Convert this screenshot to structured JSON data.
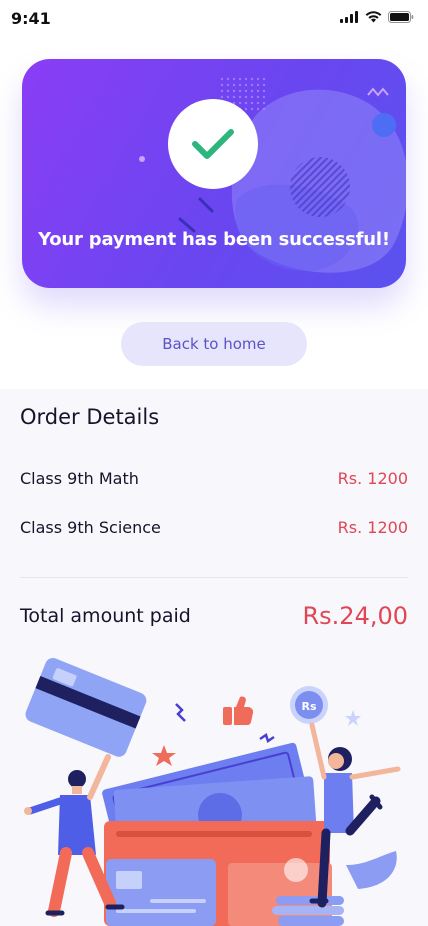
{
  "status_bar": {
    "time": "9:41",
    "icons": [
      "signal-icon",
      "wifi-icon",
      "battery-icon"
    ]
  },
  "hero": {
    "icon": "check-icon",
    "message": "Your payment has been successful!",
    "colors": {
      "gradient_start": "#8a3df5",
      "gradient_end": "#5a52ef",
      "check": "#2cb67d"
    }
  },
  "actions": {
    "back_label": "Back to home"
  },
  "order": {
    "title": "Order Details",
    "items": [
      {
        "name": "Class 9th Math",
        "price": "Rs. 1200"
      },
      {
        "name": "Class 9th Science",
        "price": "Rs. 1200"
      }
    ],
    "total_label": "Total amount paid",
    "total_value": "Rs.24,00",
    "colors": {
      "price": "#e04653",
      "text": "#15142b"
    }
  },
  "illustration": {
    "coin_label": "Rs"
  }
}
